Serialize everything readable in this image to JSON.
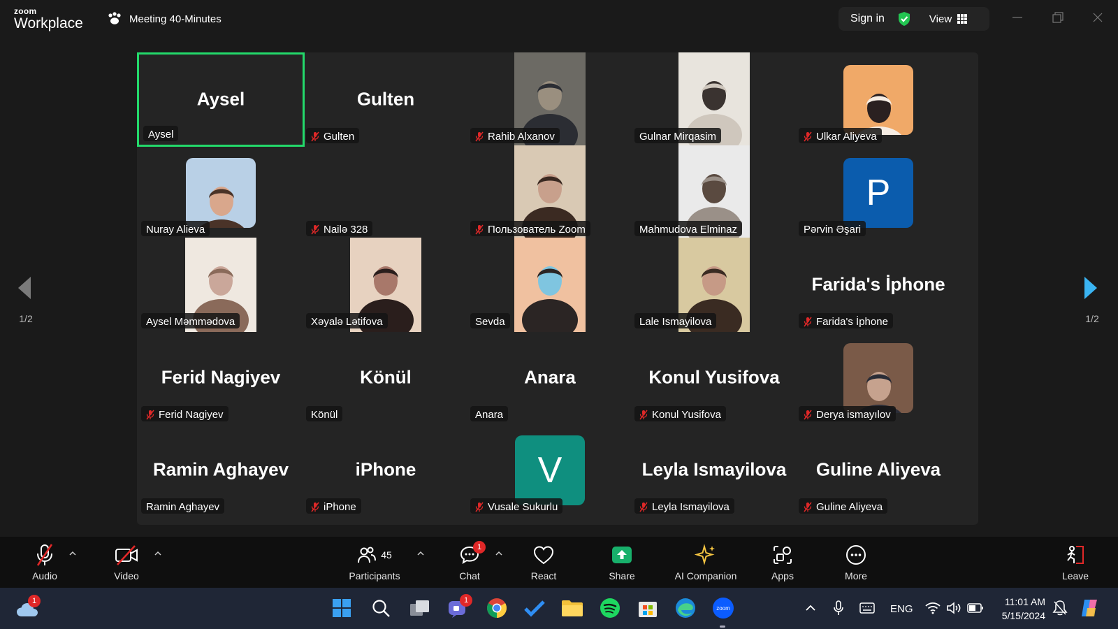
{
  "app": {
    "logo_top": "zoom",
    "logo_bottom": "Workplace",
    "meeting_title": "Meeting 40-Minutes",
    "signin_label": "Sign in",
    "view_label": "View"
  },
  "colors": {
    "active_speaker_border": "#23d96b",
    "avatar_p": "#0b5cad",
    "avatar_v": "#0f8f7f",
    "nav_arrow_active": "#3ab4f2",
    "badge": "#e02828"
  },
  "participants": [
    {
      "tile_name": "Aysel",
      "label": "Aysel",
      "muted": false,
      "active": true,
      "kind": "name"
    },
    {
      "tile_name": "Gulten",
      "label": "Gulten",
      "muted": true,
      "kind": "name"
    },
    {
      "tile_name": "",
      "label": "Rahib Alxanov",
      "muted": true,
      "kind": "video"
    },
    {
      "tile_name": "",
      "label": "Gulnar Mirqasim",
      "muted": false,
      "kind": "video"
    },
    {
      "tile_name": "",
      "label": "Ulkar Aliyeva",
      "muted": true,
      "kind": "photo"
    },
    {
      "tile_name": "",
      "label": "Nuray Alieva",
      "muted": false,
      "kind": "photo"
    },
    {
      "tile_name": "",
      "label": "Nailə 328",
      "muted": true,
      "kind": "blank"
    },
    {
      "tile_name": "",
      "label": "Пользователь Zoom",
      "muted": true,
      "kind": "video"
    },
    {
      "tile_name": "",
      "label": "Mahmudova Elminaz",
      "muted": false,
      "kind": "video"
    },
    {
      "tile_name": "P",
      "label": "Pərvin Əşari",
      "muted": false,
      "kind": "avatar"
    },
    {
      "tile_name": "",
      "label": "Aysel Məmmədova",
      "muted": false,
      "kind": "video"
    },
    {
      "tile_name": "",
      "label": "Xəyalə Lətifova",
      "muted": false,
      "kind": "video"
    },
    {
      "tile_name": "",
      "label": "Sevda",
      "muted": false,
      "kind": "video"
    },
    {
      "tile_name": "",
      "label": "Lale Ismayilova",
      "muted": false,
      "kind": "video"
    },
    {
      "tile_name": "Farida's İphone",
      "label": "Farida's İphone",
      "muted": true,
      "kind": "name"
    },
    {
      "tile_name": "Ferid Nagiyev",
      "label": "Ferid Nagiyev",
      "muted": true,
      "kind": "name"
    },
    {
      "tile_name": "Könül",
      "label": "Könül",
      "muted": false,
      "kind": "name"
    },
    {
      "tile_name": "Anara",
      "label": "Anara",
      "muted": false,
      "kind": "name"
    },
    {
      "tile_name": "Konul Yusifova",
      "label": "Konul Yusifova",
      "muted": true,
      "kind": "name"
    },
    {
      "tile_name": "",
      "label": "Derya ismayılov",
      "muted": true,
      "kind": "photo"
    },
    {
      "tile_name": "Ramin Aghayev",
      "label": "Ramin Aghayev",
      "muted": false,
      "kind": "name"
    },
    {
      "tile_name": "iPhone",
      "label": "iPhone",
      "muted": true,
      "kind": "name"
    },
    {
      "tile_name": "V",
      "label": "Vusale Sukurlu",
      "muted": true,
      "kind": "avatar"
    },
    {
      "tile_name": "Leyla Ismayilova",
      "label": "Leyla Ismayilova",
      "muted": true,
      "kind": "name"
    },
    {
      "tile_name": "Guline Aliyeva",
      "label": "Guline Aliyeva",
      "muted": true,
      "kind": "name"
    }
  ],
  "pagination": {
    "left": "1/2",
    "right": "1/2"
  },
  "toolbar": {
    "audio": "Audio",
    "video": "Video",
    "participants": "Participants",
    "participants_count": "45",
    "chat": "Chat",
    "chat_badge": "1",
    "react": "React",
    "share": "Share",
    "ai": "AI Companion",
    "apps": "Apps",
    "more": "More",
    "leave": "Leave"
  },
  "taskbar": {
    "weather_badge": "1",
    "teams_badge": "1",
    "zoom_icon_text": "zoom",
    "lang": "ENG",
    "time": "11:01 AM",
    "date": "5/15/2024"
  }
}
